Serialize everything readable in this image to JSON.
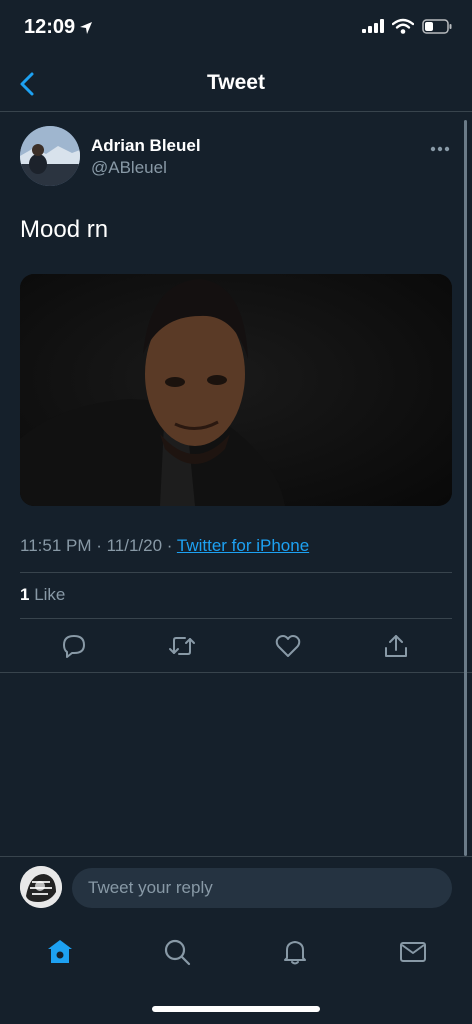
{
  "status": {
    "time": "12:09"
  },
  "nav": {
    "title": "Tweet"
  },
  "tweet": {
    "author_name": "Adrian Bleuel",
    "author_handle": "@ABleuel",
    "text": "Mood rn",
    "timestamp": "11:51 PM · 11/1/20 · ",
    "source": "Twitter for iPhone",
    "like_count": "1",
    "like_label": "Like"
  },
  "reply": {
    "placeholder": "Tweet your reply"
  },
  "colors": {
    "background": "#15202b",
    "accent": "#1da1f2",
    "muted": "#8899a6",
    "divider": "#38444d"
  }
}
